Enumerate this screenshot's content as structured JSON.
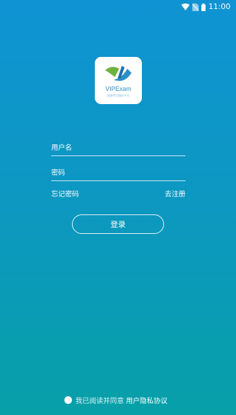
{
  "status_bar": {
    "time": "11:00",
    "icons": [
      "wifi-icon",
      "no-sim-icon",
      "battery-icon"
    ]
  },
  "logo": {
    "name": "VIPExam",
    "tagline": "维普考试服务平台"
  },
  "form": {
    "username_placeholder": "用户名",
    "password_placeholder": "密码"
  },
  "links": {
    "forgot_password": "忘记密码",
    "register": "去注册"
  },
  "login_button": "登录",
  "agreement": {
    "text": "我已阅读并同意",
    "link": "用户隐私协议"
  },
  "colors": {
    "gradient_top": "#0F93D3",
    "gradient_bottom": "#07A0A8"
  }
}
